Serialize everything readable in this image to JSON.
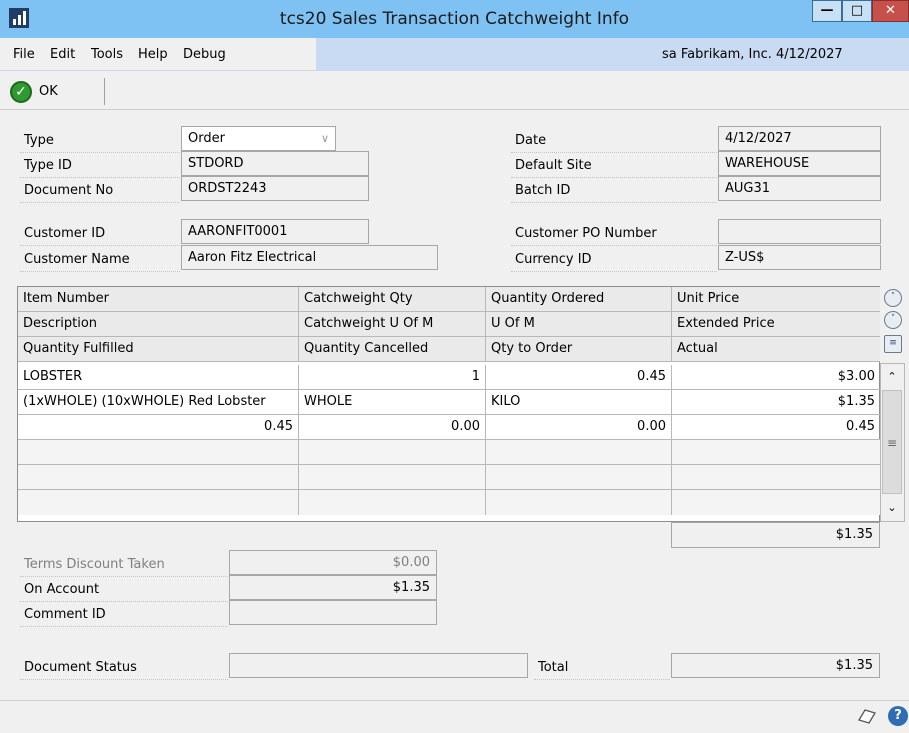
{
  "window": {
    "title": "tcs20 Sales Transaction Catchweight Info"
  },
  "menu": {
    "items": [
      "File",
      "Edit",
      "Tools",
      "Help",
      "Debug"
    ],
    "user_info": "sa  Fabrikam, Inc.  4/12/2027"
  },
  "toolbar": {
    "ok_label": "OK"
  },
  "header": {
    "type": {
      "label": "Type",
      "value": "Order"
    },
    "type_id": {
      "label": "Type ID",
      "value": "STDORD"
    },
    "document_no": {
      "label": "Document No",
      "value": "ORDST2243"
    },
    "date": {
      "label": "Date",
      "value": "4/12/2027"
    },
    "default_site": {
      "label": "Default Site",
      "value": "WAREHOUSE"
    },
    "batch_id": {
      "label": "Batch ID",
      "value": "AUG31"
    },
    "customer_id": {
      "label": "Customer ID",
      "value": "AARONFIT0001"
    },
    "customer_name": {
      "label": "Customer Name",
      "value": "Aaron Fitz Electrical"
    },
    "customer_po": {
      "label": "Customer PO Number",
      "value": ""
    },
    "currency_id": {
      "label": "Currency ID",
      "value": "Z-US$"
    }
  },
  "grid": {
    "header_rows": [
      [
        "Item Number",
        "Catchweight Qty",
        "Quantity Ordered",
        "Unit Price"
      ],
      [
        "Description",
        "Catchweight  U Of M",
        "U Of M",
        "Extended Price"
      ],
      [
        "Quantity Fulfilled",
        "Quantity Cancelled",
        "Qty to Order",
        "Actual"
      ]
    ],
    "rows": [
      [
        "LOBSTER",
        "1",
        "0.45",
        "$3.00"
      ],
      [
        "(1xWHOLE) (10xWHOLE) Red Lobster",
        "WHOLE",
        "KILO",
        "$1.35"
      ],
      [
        "0.45",
        "0.00",
        "0.00",
        "0.45"
      ]
    ],
    "total": "$1.35"
  },
  "summary": {
    "terms_discount": {
      "label": "Terms Discount Taken",
      "value": "$0.00"
    },
    "on_account": {
      "label": "On Account",
      "value": "$1.35"
    },
    "comment_id": {
      "label": "Comment ID",
      "value": ""
    },
    "document_status": {
      "label": "Document Status",
      "value": ""
    },
    "total": {
      "label": "Total",
      "value": "$1.35"
    }
  },
  "icons": {
    "app": "chart-icon",
    "ok": "check-circle-icon",
    "grid": [
      "expand-up-icon",
      "expand-down-icon",
      "row-detail-icon"
    ],
    "status": [
      "note-icon",
      "help-icon"
    ]
  },
  "colors": {
    "titlebar": "#7ec2f3",
    "menu_accent": "#c9dbf2",
    "close_button": "#c7504a",
    "ok_green": "#2f9a2f"
  }
}
